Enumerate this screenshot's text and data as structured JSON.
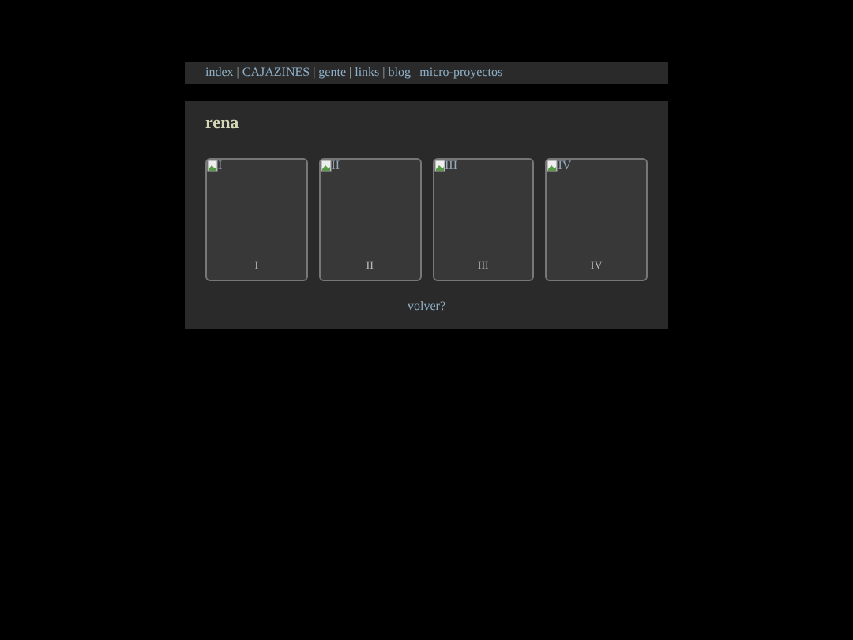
{
  "nav": {
    "links": [
      "index",
      "CAJAZINES",
      "gente",
      "links",
      "blog",
      "micro-proyectos"
    ],
    "separator": "|"
  },
  "title": "rena",
  "cards": [
    {
      "alt": "I",
      "caption": "I"
    },
    {
      "alt": "II",
      "caption": "II"
    },
    {
      "alt": "III",
      "caption": "III"
    },
    {
      "alt": "IV",
      "caption": "IV"
    }
  ],
  "back_link": "volver?"
}
